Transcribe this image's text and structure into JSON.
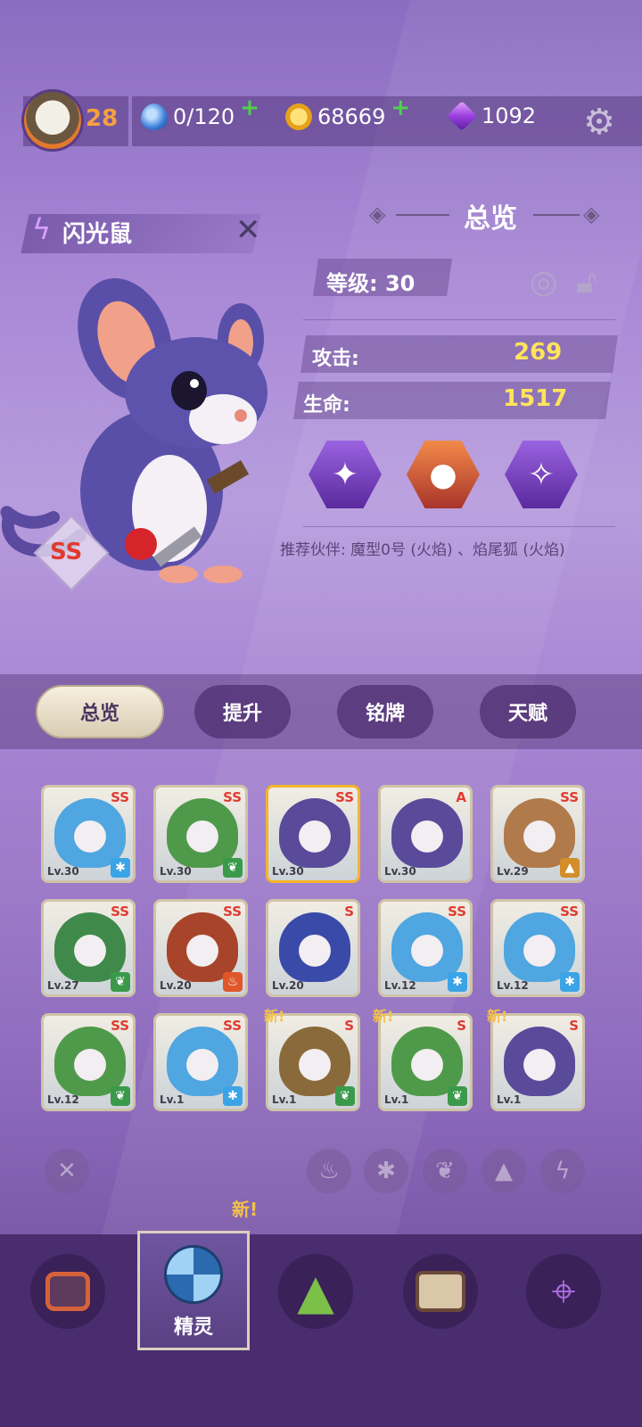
{
  "header": {
    "level": "28",
    "stamina": "0/120",
    "coins": "68669",
    "gems": "1092",
    "plus": "+"
  },
  "pet": {
    "name": "闪光鼠",
    "grade": "SS"
  },
  "overview": {
    "title": "总览",
    "level_label": "等级:",
    "level_value": "30",
    "attack_label": "攻击:",
    "attack_value": "269",
    "hp_label": "生命:",
    "hp_value": "1517",
    "recommend": "推荐伙伴: 魔型0号 (火焰) 、焰尾狐 (火焰)"
  },
  "tabs": [
    "总览",
    "提升",
    "铭牌",
    "天赋"
  ],
  "pets_grid": [
    {
      "lv": "Lv.30",
      "grade": "SS",
      "element": "ice",
      "color": "#4fa6e0"
    },
    {
      "lv": "Lv.30",
      "grade": "SS",
      "element": "leaf",
      "color": "#4f9a4a"
    },
    {
      "lv": "Lv.30",
      "grade": "SS",
      "element": "bolt",
      "color": "#5a4a9a"
    },
    {
      "lv": "Lv.30",
      "grade": "A",
      "element": "bolt",
      "color": "#5a4a9a"
    },
    {
      "lv": "Lv.29",
      "grade": "SS",
      "element": "rock",
      "color": "#b07a4a"
    },
    {
      "lv": "Lv.27",
      "grade": "SS",
      "element": "leaf",
      "color": "#3f8a4a"
    },
    {
      "lv": "Lv.20",
      "grade": "SS",
      "element": "fire",
      "color": "#a8442a"
    },
    {
      "lv": "Lv.20",
      "grade": "S",
      "element": "bolt",
      "color": "#3a4aa8"
    },
    {
      "lv": "Lv.12",
      "grade": "SS",
      "element": "ice",
      "color": "#4fa6e0"
    },
    {
      "lv": "Lv.12",
      "grade": "SS",
      "element": "ice",
      "color": "#4fa6e0"
    },
    {
      "lv": "Lv.12",
      "grade": "SS",
      "element": "leaf",
      "color": "#4f9a4a"
    },
    {
      "lv": "Lv.1",
      "grade": "SS",
      "element": "ice",
      "color": "#4fa6e0"
    },
    {
      "lv": "Lv.1",
      "grade": "S",
      "element": "leaf",
      "color": "#8a6a3a"
    },
    {
      "lv": "Lv.1",
      "grade": "S",
      "element": "leaf",
      "color": "#4f9a4a"
    },
    {
      "lv": "Lv.1",
      "grade": "S",
      "element": "bolt",
      "color": "#5a4a9a"
    }
  ],
  "new_tag": "新!",
  "nav": {
    "active_label": "精灵"
  }
}
